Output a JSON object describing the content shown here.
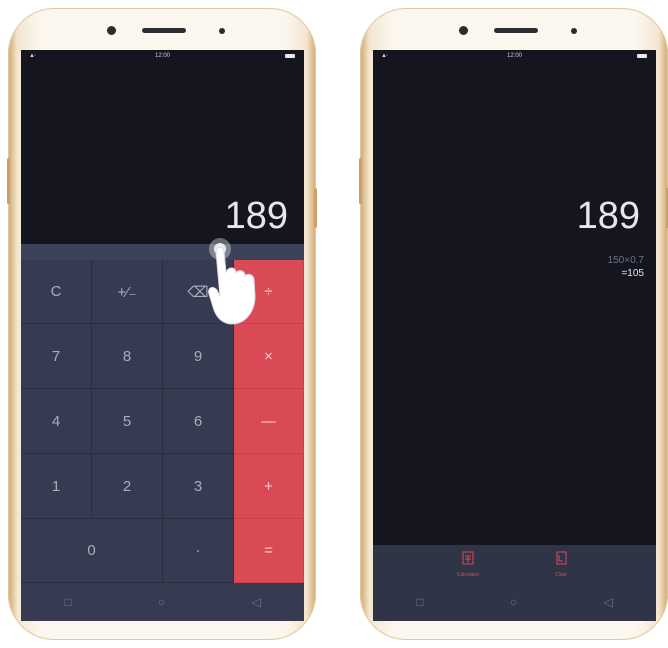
{
  "left_phone": {
    "status_time": "12:00",
    "display_value": "189",
    "keys": {
      "clear": "C",
      "plus_minus": "+⁄₋",
      "backspace": "⌫",
      "divide": "÷",
      "seven": "7",
      "eight": "8",
      "nine": "9",
      "multiply": "×",
      "four": "4",
      "five": "5",
      "six": "6",
      "minus": "—",
      "one": "1",
      "two": "2",
      "three": "3",
      "plus": "+",
      "zero": "0",
      "dot": "·",
      "equals": "="
    },
    "nav": {
      "recent": "□",
      "home": "○",
      "back": "◁"
    }
  },
  "right_phone": {
    "status_time": "12:00",
    "display_value": "189",
    "history_expression": "150×0.7",
    "history_result": "=105",
    "actions": {
      "calculator": "Calculator",
      "clear": "Clear"
    },
    "nav": {
      "recent": "□",
      "home": "○",
      "back": "◁"
    }
  },
  "colors": {
    "screen_bg": "#151520",
    "keypad_bg": "#363b52",
    "operator_red": "#d94a55",
    "phone_body": "#fbf6ee"
  }
}
